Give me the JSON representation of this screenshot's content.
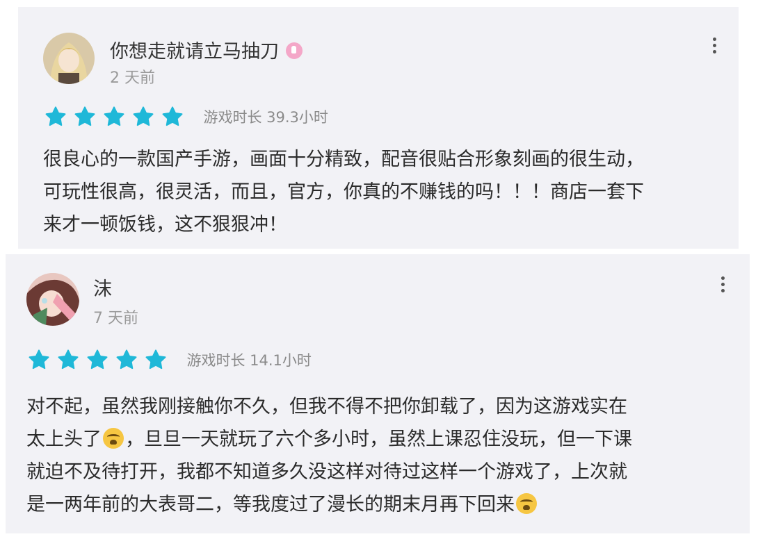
{
  "reviews": [
    {
      "username": "你想走就请立马抽刀",
      "badge_icon": "verified-badge-icon",
      "time_ago": "2 天前",
      "rating": 5,
      "playtime": "游戏时长 39.3小时",
      "text_lines": [
        "很良心的一款国产手游，画面十分精致，配音很贴合形象刻画的很生动，",
        "可玩性很高，很灵活，而且，官方，你真的不赚钱的吗！！！商店一套下",
        "来才一顿饭钱，这不狠狠冲！"
      ]
    },
    {
      "username": "沫",
      "time_ago": "7 天前",
      "rating": 5,
      "playtime": "游戏时长 14.1小时",
      "text_lines": [
        "对不起，虽然我刚接触你不久，但我不得不把你卸载了，因为这游戏实在",
        "太上头了",
        "，旦旦一天就玩了六个多小时，虽然上课忍住没玩，但一下课",
        "就迫不及待打开，我都不知道多久没这样对待过这样一个游戏了，上次就",
        "是一两年前的大表哥二，等我度过了漫长的期末月再下回来"
      ],
      "emoji_icon": "crying-face-emoji-icon"
    }
  ],
  "colors": {
    "star": "#1fb8d8",
    "card_bg": "#f2f2f6",
    "muted_text": "#9a9a9a"
  }
}
